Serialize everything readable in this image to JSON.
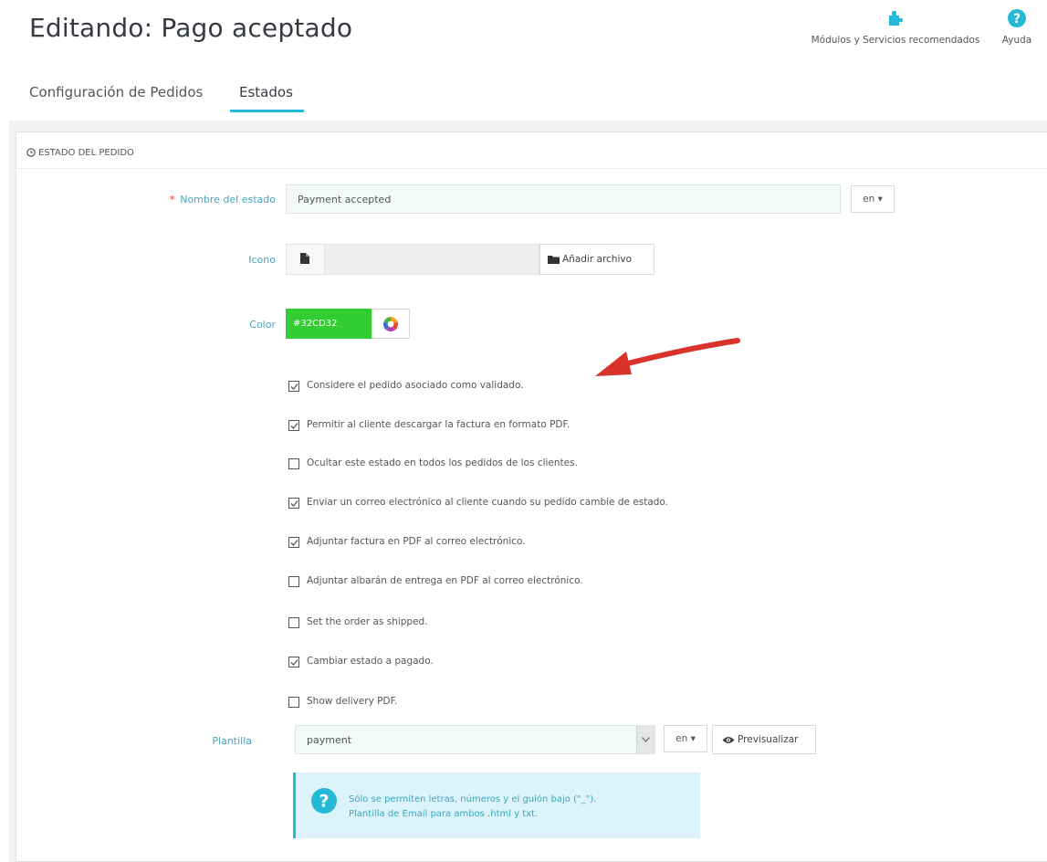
{
  "header": {
    "title": "Editando: Pago aceptado",
    "toolbar": [
      {
        "label": "Módulos y Servicios recomendados",
        "icon": "puzzle-icon"
      },
      {
        "label": "Ayuda",
        "icon": "help-icon"
      }
    ]
  },
  "tabs": [
    {
      "label": "Configuración de Pedidos",
      "active": false
    },
    {
      "label": "Estados",
      "active": true
    }
  ],
  "panel": {
    "heading": "ESTADO DEL PEDIDO",
    "heading_icon": "clock-icon"
  },
  "form": {
    "name": {
      "label": "Nombre del estado",
      "required_mark": "*",
      "value": "Payment accepted",
      "lang": "en ▾"
    },
    "icon": {
      "label": "Icono",
      "button_label": "Añadir archivo"
    },
    "color": {
      "label": "Color",
      "value": "#32CD32",
      "swatch": "#32cd32"
    },
    "checkboxes": [
      {
        "label": "Considere el pedido asociado como validado.",
        "checked": true
      },
      {
        "label": "Permitir al cliente descargar la factura en formato PDF.",
        "checked": true
      },
      {
        "label": "Ocultar este estado en todos los pedidos de los clientes.",
        "checked": false
      },
      {
        "label": "Enviar un correo electrónico al cliente cuando su pedido cambie de estado.",
        "checked": true
      },
      {
        "label": "Adjuntar factura en PDF al correo electrónico.",
        "checked": true
      },
      {
        "label": "Adjuntar albarán de entrega en PDF al correo electrónico.",
        "checked": false
      },
      {
        "label": "Set the order as shipped.",
        "checked": false
      },
      {
        "label": "Cambiar estado a pagado.",
        "checked": true
      },
      {
        "label": "Show delivery PDF.",
        "checked": false
      }
    ],
    "template": {
      "label": "Plantilla",
      "value": "payment",
      "lang": "en ▾",
      "preview_label": "Previsualizar"
    },
    "help": {
      "line1": "Sólo se permiten letras, números y el guión bajo (\"_\").",
      "line2": "Plantilla de Email para ambos .html y txt."
    }
  },
  "colors": {
    "accent": "#25b9d7",
    "label": "#4aa3c2",
    "required": "#e52f2f",
    "arrow": "#d9322b"
  }
}
